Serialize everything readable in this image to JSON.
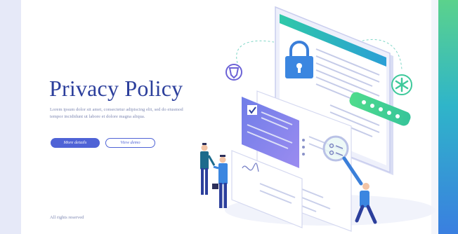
{
  "hero": {
    "title": "Privacy Policy",
    "description": "Lorem ipsum dolor sit amet, consectetur adipiscing elit, sed do eiusmod tempor incididunt ut labore et dolore magna aliqua.",
    "primary_button": "More details",
    "secondary_button": "View demo"
  },
  "footer": {
    "text": "All rights reserved"
  },
  "colors": {
    "brand": "#2c3f9c",
    "button": "#4f63d6",
    "accent_green": "#5bd28c",
    "accent_blue": "#3a7fe0"
  },
  "illustration": {
    "icons": [
      "padlock-icon",
      "shield-icon",
      "asterisk-icon",
      "password-field-icon",
      "checkbox-icon",
      "magnifier-icon",
      "signature-icon"
    ]
  }
}
